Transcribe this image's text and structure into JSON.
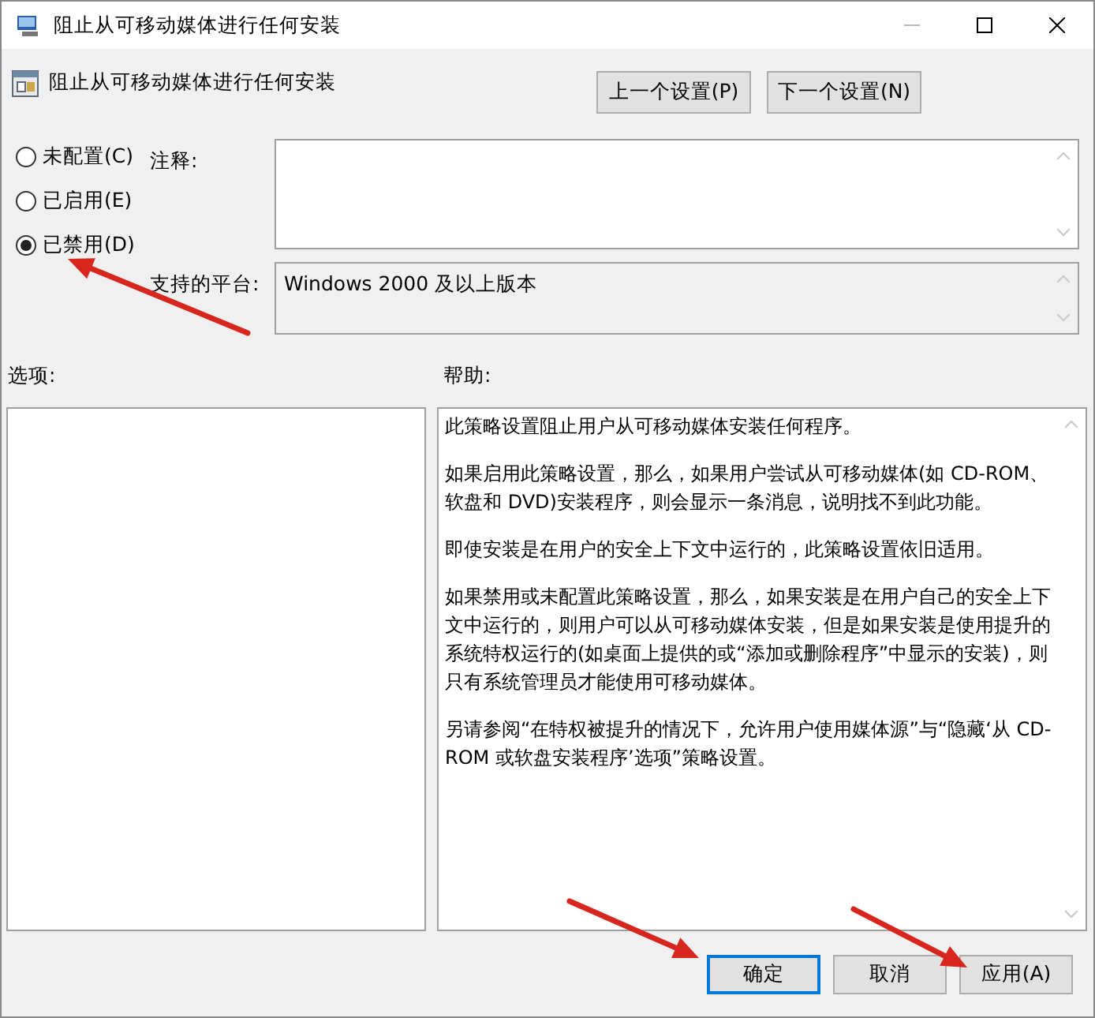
{
  "window": {
    "title": "阻止从可移动媒体进行任何安装"
  },
  "policy": {
    "title": "阻止从可移动媒体进行任何安装"
  },
  "nav_buttons": [
    "上一个设置(P)",
    "下一个设置(N)"
  ],
  "states": [
    {
      "label": "未配置(C)",
      "selected": false
    },
    {
      "label": "已启用(E)",
      "selected": false
    },
    {
      "label": "已禁用(D)",
      "selected": true
    }
  ],
  "comment": {
    "label": "注释:"
  },
  "platform": {
    "label": "支持的平台:",
    "value": "Windows 2000 及以上版本"
  },
  "options": {
    "label": "选项:"
  },
  "help": {
    "label": "帮助:",
    "paragraphs": [
      "此策略设置阻止用户从可移动媒体安装任何程序。",
      "如果启用此策略设置，那么，如果用户尝试从可移动媒体(如 CD-ROM、软盘和 DVD)安装程序，则会显示一条消息，说明找不到此功能。",
      "即使安装是在用户的安全上下文中运行的，此策略设置依旧适用。",
      "如果禁用或未配置此策略设置，那么，如果安装是在用户自己的安全上下文中运行的，则用户可以从可移动媒体安装，但是如果安装是使用提升的系统特权运行的(如桌面上提供的或“添加或删除程序”中显示的安装)，则只有系统管理员才能使用可移动媒体。",
      "另请参阅“在特权被提升的情况下，允许用户使用媒体源”与“隐藏‘从 CD-ROM 或软盘安装程序’选项”策略设置。"
    ]
  },
  "footer_buttons": [
    {
      "label": "确定",
      "kind": "default"
    },
    {
      "label": "取消",
      "kind": "normal"
    },
    {
      "label": "应用(A)",
      "kind": "normal"
    }
  ]
}
